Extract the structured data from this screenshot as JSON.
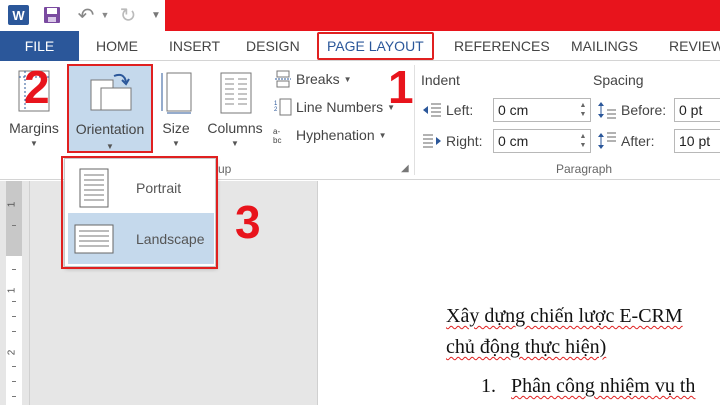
{
  "quick_access": {
    "app_icon_letter": "W",
    "icons": [
      "word-icon",
      "save-icon",
      "undo-icon",
      "redo-icon",
      "customize-dropdown-icon"
    ]
  },
  "tabs": [
    {
      "label": "FILE"
    },
    {
      "label": "HOME"
    },
    {
      "label": "INSERT"
    },
    {
      "label": "DESIGN"
    },
    {
      "label": "PAGE LAYOUT"
    },
    {
      "label": "REFERENCES"
    },
    {
      "label": "MAILINGS"
    },
    {
      "label": "REVIEW"
    }
  ],
  "active_tab": "PAGE LAYOUT",
  "page_setup": {
    "margins_label": "Margins",
    "orientation_label": "Orientation",
    "size_label": "Size",
    "columns_label": "Columns",
    "breaks_label": "Breaks",
    "line_numbers_label": "Line Numbers",
    "hyphenation_label": "Hyphenation",
    "group_label_fragment": "up"
  },
  "paragraph": {
    "indent_title": "Indent",
    "spacing_title": "Spacing",
    "left_label": "Left:",
    "right_label": "Right:",
    "left_value": "0 cm",
    "right_value": "0 cm",
    "before_label": "Before:",
    "after_label": "After:",
    "before_value": "0 pt",
    "after_value": "10 pt",
    "group_label": "Paragraph"
  },
  "orientation_menu": {
    "options": [
      {
        "label": "Portrait"
      },
      {
        "label": "Landscape"
      }
    ],
    "highlighted": "Landscape"
  },
  "ruler": {
    "numbers": [
      "1",
      "1",
      "2"
    ]
  },
  "document": {
    "line1": "Xây dựng chiến lược E-CRM",
    "line2": "chủ động thực hiện)",
    "line3_num": "1.",
    "line3": "Phân công nhiệm vụ th"
  },
  "callouts": [
    "1",
    "2",
    "3"
  ],
  "colors": {
    "word_blue": "#2b579a",
    "title_red": "#e8141c",
    "highlight_blue": "#c5d9ec",
    "annotation_red": "#e02020"
  }
}
